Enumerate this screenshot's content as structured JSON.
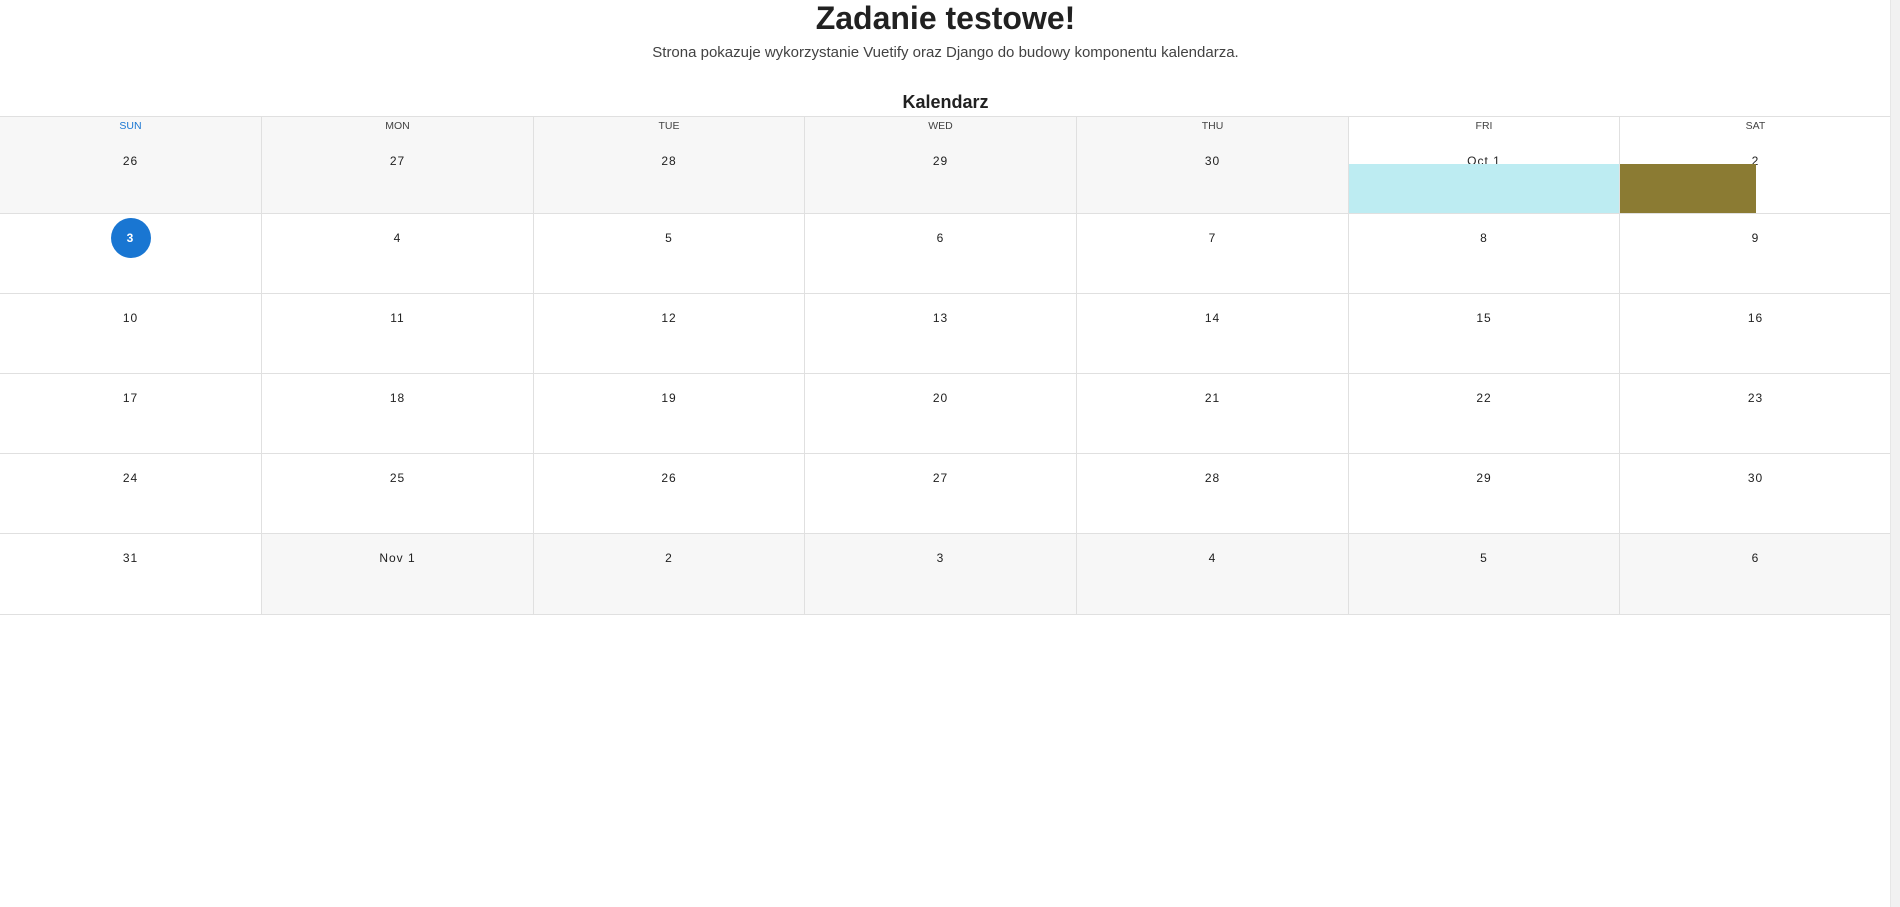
{
  "page": {
    "title": "Zadanie testowe!",
    "subtitle": "Strona pokazuje wykorzystanie Vuetify oraz Django do budowy komponentu kalendarza."
  },
  "calendar": {
    "title": "Kalendarz",
    "weekdays": [
      "SUN",
      "MON",
      "TUE",
      "WED",
      "THU",
      "FRI",
      "SAT"
    ],
    "current_weekday_index": 0,
    "today": "3",
    "weeks": [
      {
        "days": [
          {
            "label": "26",
            "outside": true
          },
          {
            "label": "27",
            "outside": true
          },
          {
            "label": "28",
            "outside": true
          },
          {
            "label": "29",
            "outside": true
          },
          {
            "label": "30",
            "outside": true
          },
          {
            "label": "Oct 1",
            "outside": false
          },
          {
            "label": "2",
            "outside": false
          }
        ]
      },
      {
        "days": [
          {
            "label": "3",
            "outside": false,
            "today": true
          },
          {
            "label": "4",
            "outside": false
          },
          {
            "label": "5",
            "outside": false
          },
          {
            "label": "6",
            "outside": false
          },
          {
            "label": "7",
            "outside": false
          },
          {
            "label": "8",
            "outside": false
          },
          {
            "label": "9",
            "outside": false
          }
        ]
      },
      {
        "days": [
          {
            "label": "10",
            "outside": false
          },
          {
            "label": "11",
            "outside": false
          },
          {
            "label": "12",
            "outside": false
          },
          {
            "label": "13",
            "outside": false
          },
          {
            "label": "14",
            "outside": false
          },
          {
            "label": "15",
            "outside": false
          },
          {
            "label": "16",
            "outside": false
          }
        ]
      },
      {
        "days": [
          {
            "label": "17",
            "outside": false
          },
          {
            "label": "18",
            "outside": false
          },
          {
            "label": "19",
            "outside": false
          },
          {
            "label": "20",
            "outside": false
          },
          {
            "label": "21",
            "outside": false
          },
          {
            "label": "22",
            "outside": false
          },
          {
            "label": "23",
            "outside": false
          }
        ]
      },
      {
        "days": [
          {
            "label": "24",
            "outside": false
          },
          {
            "label": "25",
            "outside": false
          },
          {
            "label": "26",
            "outside": false
          },
          {
            "label": "27",
            "outside": false
          },
          {
            "label": "28",
            "outside": false
          },
          {
            "label": "29",
            "outside": false
          },
          {
            "label": "30",
            "outside": false
          }
        ]
      },
      {
        "days": [
          {
            "label": "31",
            "outside": false
          },
          {
            "label": "Nov 1",
            "outside": true
          },
          {
            "label": "2",
            "outside": true
          },
          {
            "label": "3",
            "outside": true
          },
          {
            "label": "4",
            "outside": true
          },
          {
            "label": "5",
            "outside": true
          },
          {
            "label": "6",
            "outside": true
          }
        ]
      }
    ],
    "events": [
      {
        "day": "Oct 1",
        "color": "#bdecf2"
      },
      {
        "day": "2",
        "color": "#8b7b33"
      }
    ]
  },
  "colors": {
    "accent": "#1976d2",
    "outside_day_bg": "#f7f7f7",
    "border": "#e0e0e0"
  }
}
